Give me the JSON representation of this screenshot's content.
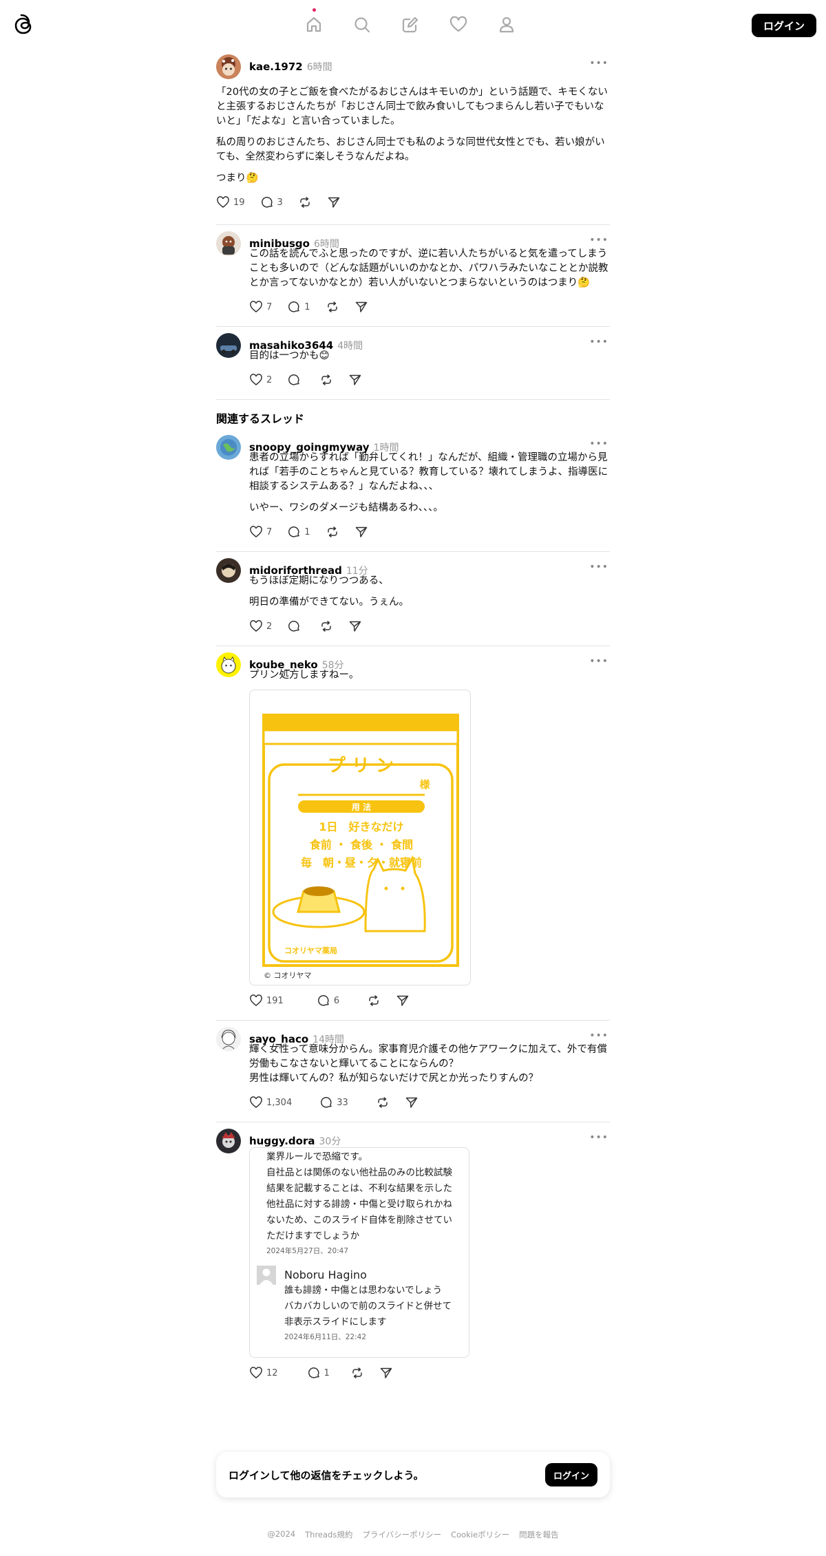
{
  "header": {
    "login_label": "ログイン",
    "nav": [
      "home-icon",
      "search-icon",
      "compose-icon",
      "heart-icon",
      "profile-icon"
    ]
  },
  "main_post": {
    "username": "kae.1972",
    "time": "6時間",
    "paragraphs": [
      "「20代の女の子とご飯を食べたがるおじさんはキモいのか」という話題で、キモくないと主張するおじさんたちが「おじさん同士で飲み食いしてもつまらんし若い子でもいないと」「だよな」と言い合っていました。",
      "私の周りのおじさんたち、おじさん同士でも私のような同世代女性とでも、若い娘がいても、全然変わらずに楽しそうなんだよね。",
      "つまり🤔"
    ],
    "likes": "19",
    "replies": "3"
  },
  "replies": [
    {
      "username": "minibusgo",
      "time": "6時間",
      "paragraphs": [
        "この話を読んでふと思ったのですが、逆に若い人たちがいると気を遣ってしまうことも多いので（どんな話題がいいのかなとか、パワハラみたいなこととか説教とか言ってないかなとか）若い人がいないとつまらないというのはつまり🤔"
      ],
      "likes": "7",
      "replies": "1"
    },
    {
      "username": "masahiko3644",
      "time": "4時間",
      "paragraphs": [
        "目的は一つかも😊"
      ],
      "likes": "2",
      "replies": ""
    }
  ],
  "related_title": "関連するスレッド",
  "related": [
    {
      "username": "snoopy_goingmyway",
      "time": "1時間",
      "paragraphs": [
        "患者の立場からすれば「勤弁してくれ！」なんだが、組織・管理職の立場から見れば「若手のことちゃんと見ている？教育している？壊れてしまうよ、指導医に相談するシステムある？」なんだよね、、、",
        "いやー、ワシのダメージも結構あるわ、、、。"
      ],
      "likes": "7",
      "replies": "1"
    },
    {
      "username": "midoriforthread",
      "time": "11分",
      "paragraphs": [
        "もうほぼ定期になりつつある、",
        "明日の準備ができてない。うぇん。"
      ],
      "likes": "2",
      "replies": ""
    },
    {
      "username": "koube_neko",
      "time": "58分",
      "paragraphs": [
        "プリン処方しますねー。"
      ],
      "likes": "191",
      "replies": "6",
      "image": {
        "title": "プ リ ン",
        "sama": "様",
        "usage": "用 法",
        "line1": "1日　好きなだけ",
        "line2": "食前 ・ 食後 ・ 食間",
        "line3": "毎　朝・昼・夕・就寝前",
        "pharmacy": "コオリヤマ薬局",
        "credit": "© コオリヤマ",
        "color": "#f7c310"
      }
    },
    {
      "username": "sayo_haco",
      "time": "14時間",
      "paragraphs": [
        "輝く女性って意味分からん。家事育児介護その他ケアワークに加えて、外で有償労働もこなさないと輝いてることにならんの？\n男性は輝いてんの？私が知らないだけで尻とか光ったりすんの？"
      ],
      "likes": "1,304",
      "replies": "33"
    },
    {
      "username": "huggy.dora",
      "time": "30分",
      "paragraphs": [],
      "likes": "12",
      "replies": "1",
      "quote": {
        "text": "業界ルールで恐縮です。\n自社品とは関係のない他社品のみの比較試験結果を記載することは、不利な結果を示した他社品に対する誹謗・中傷と受け取られかねないため、このスライド自体を削除させていただけますでしょうか",
        "date": "2024年5月27日、20:47",
        "reply_name": "Noboru Hagino",
        "reply_text": "誰も誹謗・中傷とは思わないでしょう\nバカバカしいので前のスライドと併せて非表示スライドにします",
        "reply_date": "2024年6月11日、22:42"
      }
    }
  ],
  "login_card": {
    "text": "ログインして他の返信をチェックしよう。",
    "button": "ログイン"
  },
  "footer": [
    "@2024",
    "Threads規約",
    "プライバシーポリシー",
    "Cookieポリシー",
    "問題を報告"
  ]
}
